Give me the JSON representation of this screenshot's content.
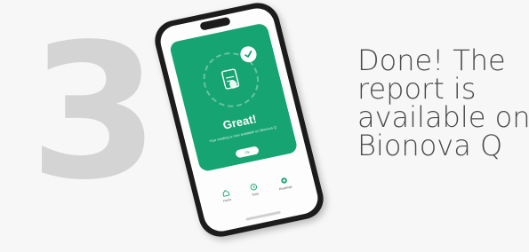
{
  "step": {
    "number": "3"
  },
  "message": {
    "lines": [
      "Done! The",
      "report is",
      "available on",
      "Bionova Q"
    ]
  },
  "phone": {
    "success": {
      "title": "Great!",
      "subtitle": "Your reading is now available on Bionova Q",
      "ok_label": "Ok"
    },
    "tabs": [
      {
        "label": "Home",
        "icon": "home-icon"
      },
      {
        "label": "Tests",
        "icon": "clock-icon"
      },
      {
        "label": "Readings",
        "icon": "readings-icon"
      }
    ],
    "colors": {
      "accent": "#16a472",
      "frame": "#1c1c1c"
    }
  }
}
